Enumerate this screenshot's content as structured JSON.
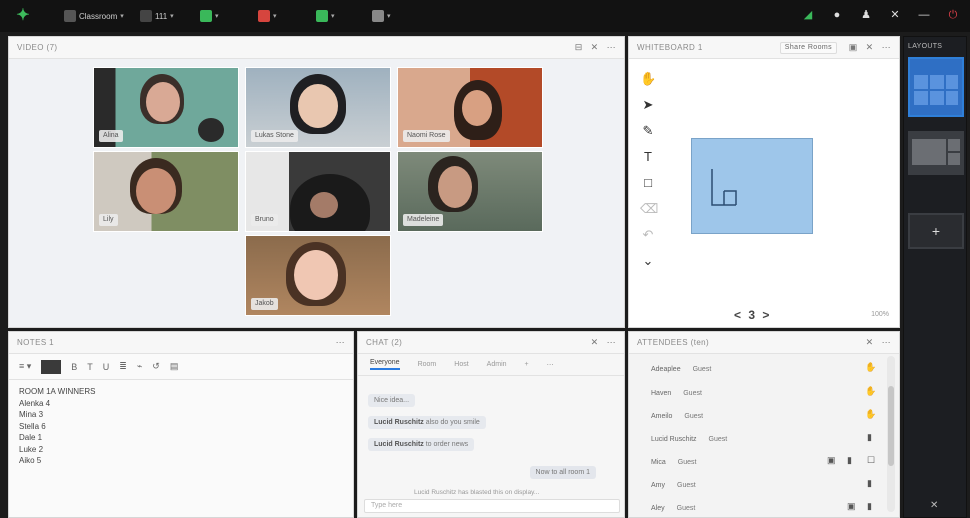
{
  "topbar": {
    "menus": [
      {
        "label": "Classroom",
        "icon": "gear-icon"
      },
      {
        "label": "111",
        "icon": "grid-icon"
      },
      {
        "label": "",
        "icon": "speaker-icon"
      },
      {
        "label": "",
        "icon": "mic-icon"
      },
      {
        "label": "",
        "icon": "camera-icon"
      },
      {
        "label": "",
        "icon": "share-icon"
      }
    ],
    "right_icons": [
      "signal-icon",
      "help-icon",
      "user-icon",
      "expand-icon",
      "minimize-icon",
      "power-icon"
    ]
  },
  "video_pane": {
    "title": "VIDEO (7)",
    "participants": [
      {
        "name": "Alina"
      },
      {
        "name": "Lukas Stone"
      },
      {
        "name": "Naomi Rose"
      },
      {
        "name": "Lily"
      },
      {
        "name": "Bruno"
      },
      {
        "name": "Madeleine"
      },
      {
        "name": "Jakob"
      }
    ]
  },
  "whiteboard": {
    "title": "WHITEBOARD 1",
    "share_label": "Share Rooms",
    "nav": "< 3 >",
    "zoom": "100%"
  },
  "layouts": {
    "title": "LAYOUTS"
  },
  "notes": {
    "title": "NOTES 1",
    "lines": [
      "ROOM 1A WINNERS",
      "Alenka 4",
      "Mina 3",
      "Stella 6",
      "Dale 1",
      "Luke 2",
      "Aiko 5"
    ]
  },
  "chat": {
    "title": "CHAT (2)",
    "tabs": [
      "Everyone",
      "Room",
      "Host",
      "Admin"
    ],
    "messages": [
      {
        "sender": "",
        "text": "Nice idea..."
      },
      {
        "sender": "Lucid Ruschitz",
        "text": "also do you  smile"
      },
      {
        "sender": "Lucid Ruschitz",
        "text": "to order news"
      },
      {
        "sender": "",
        "text": "Now to all room 1"
      }
    ],
    "status_text": "Lucid Ruschitz has blasted this on display...",
    "input_placeholder": "Type here"
  },
  "attendees": {
    "title": "ATTENDEES (ten)",
    "list": [
      {
        "name": "Adeaplee",
        "role": "Guest"
      },
      {
        "name": "Haven",
        "role": "Guest"
      },
      {
        "name": "Ameilo",
        "role": "Guest"
      },
      {
        "name": "Lucid Ruschitz",
        "role": "Guest"
      },
      {
        "name": "Mica",
        "role": "Guest"
      },
      {
        "name": "Amy",
        "role": "Guest"
      },
      {
        "name": "Aley",
        "role": "Guest"
      }
    ]
  }
}
